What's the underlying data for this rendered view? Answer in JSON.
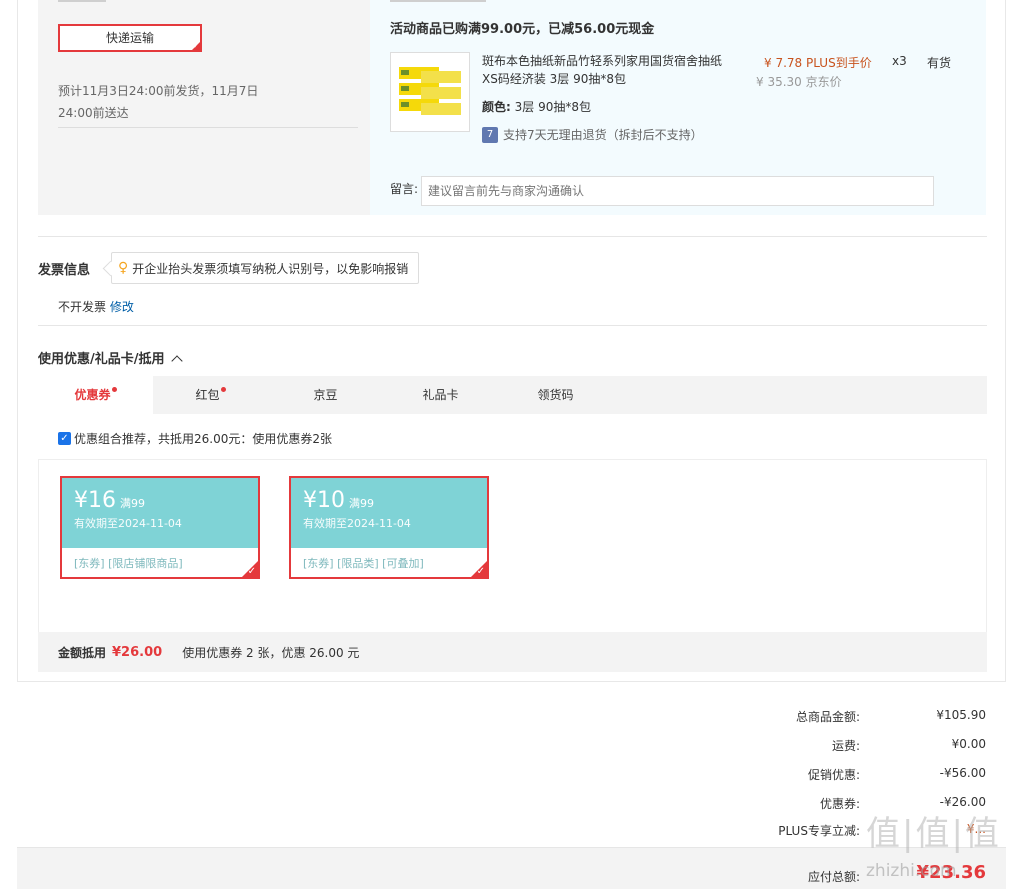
{
  "shipping": {
    "method": "快递运输",
    "estimate": "预计11月3日24:00前发货，11月7日24:00前送达"
  },
  "goods": {
    "promo_text": "活动商品已购满99.00元，已减56.00元现金",
    "product_name": "斑布本色抽纸新品竹轻系列家用国货宿舍抽纸XS码经济装 3层 90抽*8包",
    "color_label": "颜色:",
    "color_value": "3层 90抽*8包",
    "return_icon": "7",
    "return_policy": "支持7天无理由退货（拆封后不支持）",
    "plus_price": "¥  7.78 PLUS到手价",
    "jd_price": "¥  35.30 京东价",
    "quantity": "x3",
    "stock": "有货",
    "note_label": "留言:",
    "note_placeholder": "建议留言前先与商家沟通确认"
  },
  "invoice": {
    "title": "发票信息",
    "tip": "开企业抬头发票须填写纳税人识别号，以免影响报销",
    "status": "不开发票",
    "edit_link": "修改"
  },
  "discount": {
    "title": "使用优惠/礼品卡/抵用",
    "tabs": [
      {
        "label": "优惠券",
        "dot": true
      },
      {
        "label": "红包",
        "dot": true
      },
      {
        "label": "京豆",
        "dot": false
      },
      {
        "label": "礼品卡",
        "dot": false
      },
      {
        "label": "领货码",
        "dot": false
      }
    ],
    "combo_text": "优惠组合推荐，共抵用26.00元：使用优惠券2张",
    "coupons": [
      {
        "amount": "¥16",
        "condition": "满99",
        "expiry": "有效期至2024-11-04",
        "tags": "[东券]  [限店铺限商品]"
      },
      {
        "amount": "¥10",
        "condition": "满99",
        "expiry": "有效期至2024-11-04",
        "tags": "[东券]  [限品类]  [可叠加]"
      }
    ],
    "summary_label": "金额抵用",
    "summary_amount": "¥26.00",
    "summary_text": "使用优惠券 2 张，优惠 26.00 元"
  },
  "totals": {
    "rows": [
      {
        "label": "总商品金额:",
        "value": "¥105.90"
      },
      {
        "label": "运费:",
        "value": "¥0.00"
      },
      {
        "label": "促销优惠:",
        "value": "-¥56.00"
      },
      {
        "label": "优惠券:",
        "value": "-¥26.00"
      },
      {
        "label": "PLUS专享立减:",
        "value": "¥..."
      }
    ],
    "pay_label": "应付总额:",
    "pay_value": "¥23.36"
  },
  "watermark": {
    "text": "值|值|值",
    "sub": "zhizhi.com"
  },
  "colors": {
    "accent": "#e4393c",
    "coupon": "#7fd3d6",
    "link": "#005ea7",
    "plus": "#c8531e"
  }
}
